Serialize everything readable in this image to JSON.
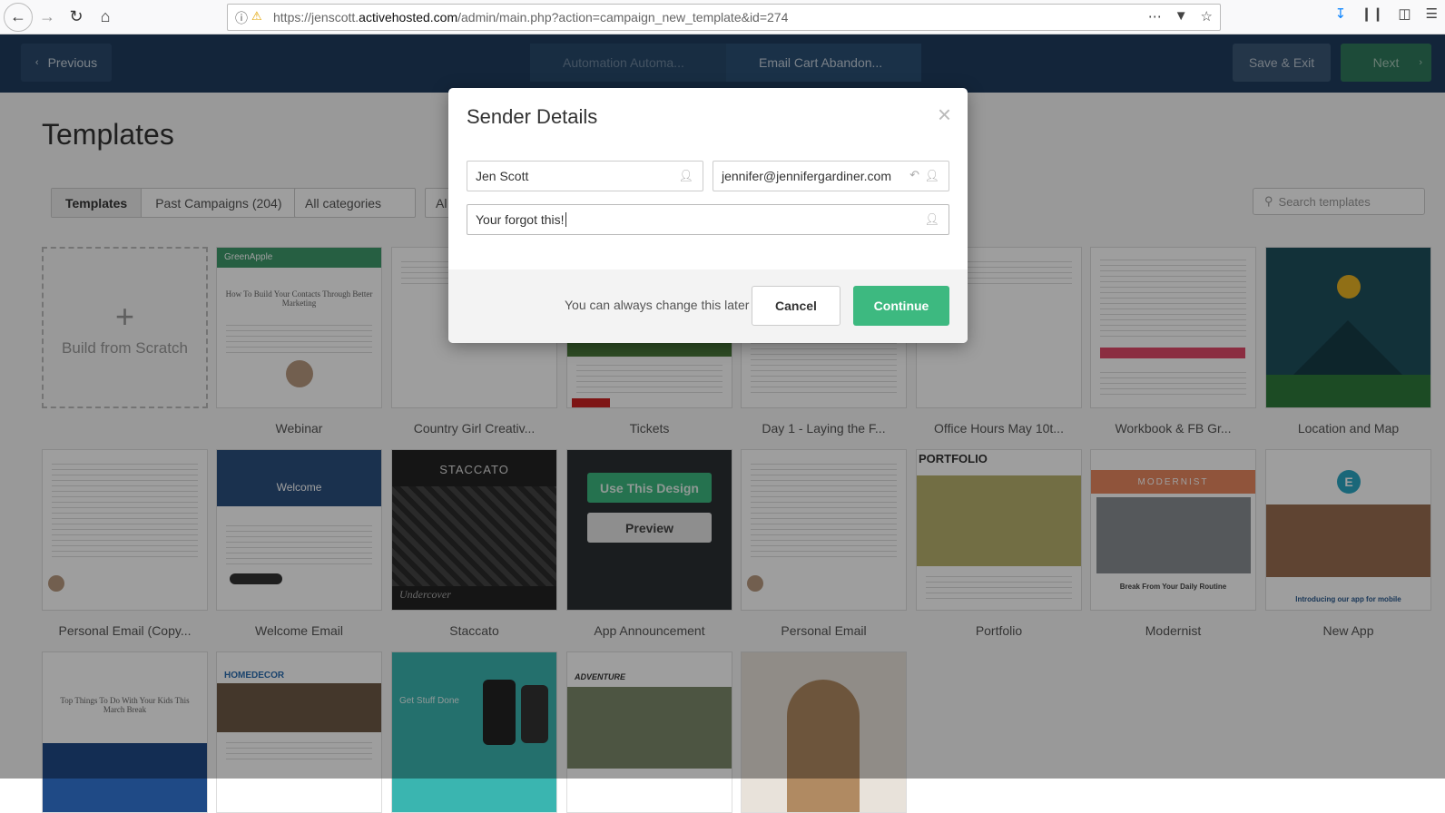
{
  "browser": {
    "url_prefix": "https://jenscott.",
    "url_host": "activehosted.com",
    "url_path": "/admin/main.php?action=campaign_new_template&id=274"
  },
  "header": {
    "previous_label": "Previous",
    "crumbs": [
      "Automation Automa...",
      "Email Cart Abandon..."
    ],
    "save_exit_label": "Save & Exit",
    "next_label": "Next"
  },
  "page": {
    "title": "Templates",
    "tabs": [
      "Templates",
      "Past Campaigns (204)"
    ],
    "category_select": "All categories",
    "second_select": "Al",
    "search_placeholder": "Search templates"
  },
  "templates": {
    "build_from_scratch": "Build from Scratch",
    "row1": [
      "Webinar",
      "Country Girl Creativ...",
      "Tickets",
      "Day 1 - Laying the F...",
      "Office Hours May 10t...",
      "Workbook & FB Gr...",
      "Location and Map"
    ],
    "row2": [
      "Personal Email (Copy...",
      "Welcome Email",
      "Staccato",
      "App Announcement",
      "Personal Email",
      "Portfolio",
      "Modernist",
      "New App"
    ],
    "use_design_label": "Use This Design",
    "preview_label": "Preview",
    "thumb_texts": {
      "greenapple": "GreenApple",
      "webinar_heading": "How To Build Your Contacts Through Better Marketing",
      "welcome": "Welcome",
      "staccato": "STACCATO",
      "undercover": "Undercover",
      "portfolio": "PORTFOLIO",
      "modernist": "MODERNIST",
      "modernist_caption": "Break From Your Daily Routine",
      "newapp_caption": "Introducing our app for mobile",
      "playground_heading": "Top Things To Do With Your Kids This March Break",
      "homedecor": "HOMEDECOR",
      "get_stuff_done": "Get Stuff Done",
      "adventure": "ADVENTURE"
    }
  },
  "modal": {
    "title": "Sender Details",
    "name_value": "Jen Scott",
    "email_value": "jennifer@jennifergardiner.com",
    "subject_value": "Your forgot this!",
    "footer_note": "You can always change this later",
    "cancel_label": "Cancel",
    "continue_label": "Continue"
  },
  "colors": {
    "header_bg": "#1f3d5e",
    "continue_green": "#3db980"
  }
}
